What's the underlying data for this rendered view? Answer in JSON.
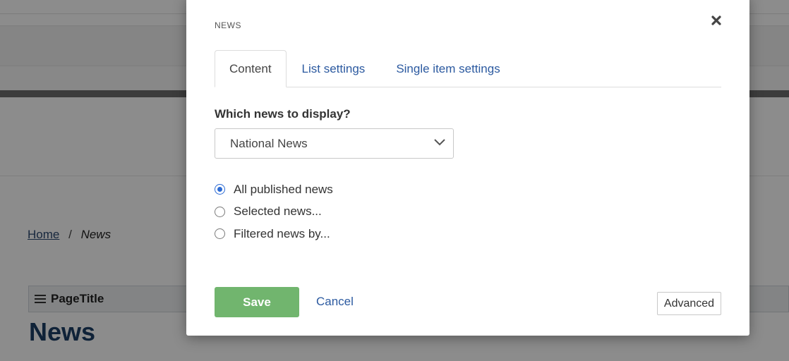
{
  "background": {
    "breadcrumb": {
      "home": "Home",
      "separator": "/",
      "current": "News"
    },
    "page_title_widget": "PageTitle",
    "heading": "News"
  },
  "modal": {
    "title": "NEWS",
    "close_icon": "close-icon",
    "tabs": [
      {
        "label": "Content",
        "active": true
      },
      {
        "label": "List settings",
        "active": false
      },
      {
        "label": "Single item settings",
        "active": false
      }
    ],
    "which_label": "Which news to display?",
    "news_select": {
      "value": "National News"
    },
    "radios": [
      {
        "label": "All published news",
        "checked": true
      },
      {
        "label": "Selected news...",
        "checked": false
      },
      {
        "label": "Filtered news by...",
        "checked": false
      }
    ],
    "save_label": "Save",
    "cancel_label": "Cancel",
    "advanced_label": "Advanced"
  },
  "colors": {
    "accent": "#2c5aa0",
    "save_button": "#71b56e",
    "radio_checked": "#2c6bd4",
    "heading": "#1c3f66"
  }
}
